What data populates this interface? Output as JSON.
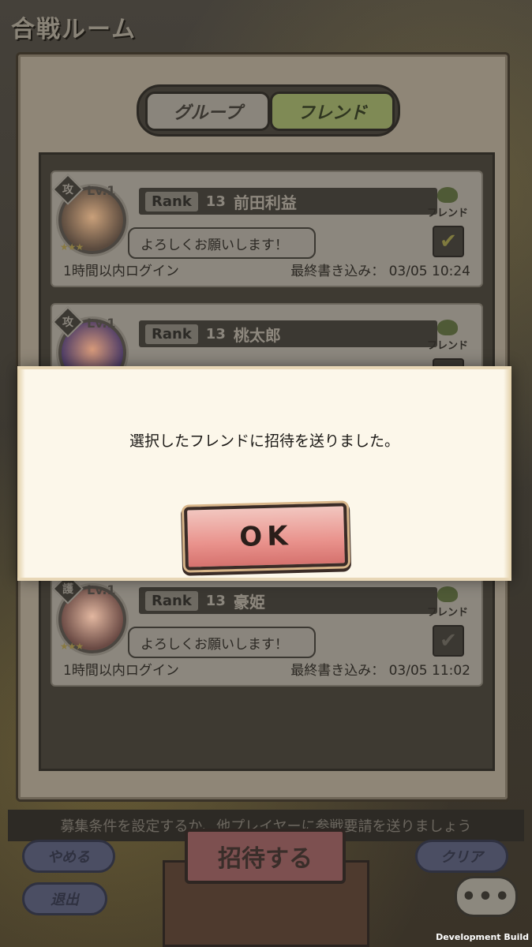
{
  "screen": {
    "title": "合戦ルーム"
  },
  "tabs": {
    "group_label": "グループ",
    "friend_label": "フレンド"
  },
  "friends": [
    {
      "type_badge": "攻",
      "level": "Lv.1",
      "rank_label": "Rank",
      "rank_value": "13",
      "name": "前田利益",
      "tag": "フレンド",
      "message": "よろしくお願いします！",
      "login_status": "1時間以内ログイン",
      "last_write_label": "最終書き込み：",
      "last_write_time": "03/05 10:24",
      "checked": true
    },
    {
      "type_badge": "攻",
      "level": "Lv.1",
      "rank_label": "Rank",
      "rank_value": "13",
      "name": "桃太郎",
      "tag": "フレンド",
      "checked": true
    },
    {
      "type_badge": "護",
      "level": "Lv.1",
      "rank_label": "Rank",
      "rank_value": "13",
      "name": "豪姫",
      "tag": "フレンド",
      "message": "よろしくお願いします！",
      "login_status": "1時間以内ログイン",
      "last_write_label": "最終書き込み：",
      "last_write_time": "03/05 11:02",
      "checked": false
    }
  ],
  "footer": {
    "hint": "募集条件を設定するか、他プレイヤーに参戦要請を送りましょう",
    "quit_label": "やめる",
    "exit_label": "退出",
    "invite_label": "招待する",
    "clear_label": "クリア",
    "chat_label": "•••"
  },
  "dialog": {
    "message": "選択したフレンドに招待を送りました。",
    "ok_label": "OK"
  },
  "build": {
    "label": "Development Build"
  }
}
